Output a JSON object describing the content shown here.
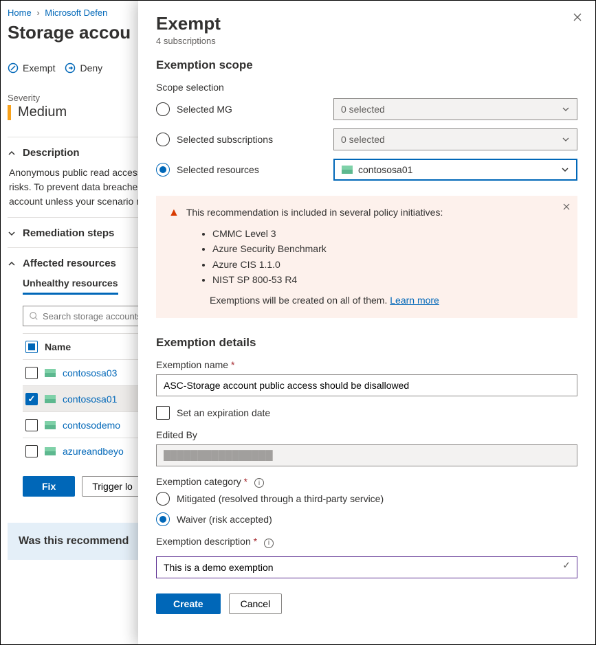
{
  "breadcrumb": {
    "home": "Home",
    "second": "Microsoft Defen"
  },
  "page_title": "Storage accou",
  "actions": {
    "exempt": "Exempt",
    "deny": "Deny"
  },
  "severity": {
    "label": "Severity",
    "value": "Medium"
  },
  "description": {
    "header": "Description",
    "text": "Anonymous public read access to containers and blobs in Azure Storage is a convenient way to share data but might present security risks. To prevent data breaches caused by undesired anonymous access, Microsoft recommends preventing public access to a storage account unless your scenario requires it."
  },
  "remediation_header": "Remediation steps",
  "affected": {
    "header": "Affected resources",
    "tab": "Unhealthy resources",
    "search_placeholder": "Search storage accounts",
    "col_name": "Name",
    "rows": [
      {
        "name": "contososa03",
        "selected": false
      },
      {
        "name": "contososa01",
        "selected": true
      },
      {
        "name": "contosodemo",
        "selected": false
      },
      {
        "name": "azureandbeyo",
        "selected": false
      }
    ]
  },
  "buttons": {
    "fix": "Fix",
    "trigger": "Trigger lo"
  },
  "feedback": "Was this recommend",
  "panel": {
    "title": "Exempt",
    "subtitle": "4 subscriptions",
    "scope": {
      "header": "Exemption scope",
      "label": "Scope selection",
      "mg": "Selected MG",
      "subs": "Selected subscriptions",
      "res": "Selected resources",
      "zero": "0 selected",
      "selected_resource": "contososa01"
    },
    "warn": {
      "lead": "This recommendation is included in several policy initiatives:",
      "items": [
        "CMMC Level 3",
        "Azure Security Benchmark",
        "Azure CIS 1.1.0",
        "NIST SP 800-53 R4"
      ],
      "footer": "Exemptions will be created on all of them.",
      "link": "Learn more"
    },
    "details": {
      "header": "Exemption details",
      "name_label": "Exemption name",
      "name_value": "ASC-Storage account public access should be disallowed",
      "expire": "Set an expiration date",
      "edited_by_label": "Edited By",
      "edited_by_value": "",
      "category_label": "Exemption category",
      "mitigated": "Mitigated (resolved through a third-party service)",
      "waiver": "Waiver (risk accepted)",
      "desc_label": "Exemption description",
      "desc_value": "This is a demo exemption"
    },
    "buttons": {
      "create": "Create",
      "cancel": "Cancel"
    }
  }
}
